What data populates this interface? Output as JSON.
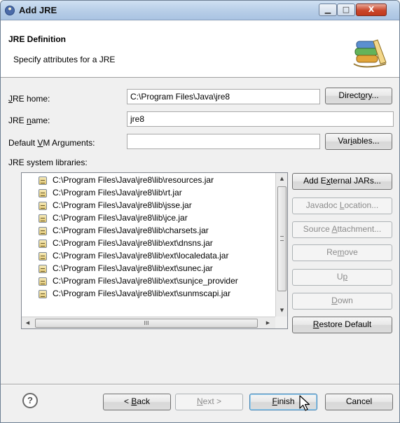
{
  "window": {
    "title": "Add JRE"
  },
  "header": {
    "title": "JRE Definition",
    "description": "Specify attributes for a JRE",
    "icon": "jre-books-icon"
  },
  "form": {
    "jre_home": {
      "label_pre": "",
      "label_u": "J",
      "label_post": "RE home:",
      "value": "C:\\Program Files\\Java\\jre8"
    },
    "directory_button": {
      "pre": "Direct",
      "u": "o",
      "post": "ry..."
    },
    "jre_name": {
      "label_pre": "JRE ",
      "label_u": "n",
      "label_post": "ame:",
      "value": "jre8"
    },
    "vm_args": {
      "label_pre": "Default ",
      "label_u": "V",
      "label_post": "M Arguments:",
      "value": ""
    },
    "variables_button": {
      "pre": "Var",
      "u": "i",
      "post": "ables..."
    },
    "libraries_label": "JRE system libraries:"
  },
  "libraries": [
    "C:\\Program Files\\Java\\jre8\\lib\\resources.jar",
    "C:\\Program Files\\Java\\jre8\\lib\\rt.jar",
    "C:\\Program Files\\Java\\jre8\\lib\\jsse.jar",
    "C:\\Program Files\\Java\\jre8\\lib\\jce.jar",
    "C:\\Program Files\\Java\\jre8\\lib\\charsets.jar",
    "C:\\Program Files\\Java\\jre8\\lib\\ext\\dnsns.jar",
    "C:\\Program Files\\Java\\jre8\\lib\\ext\\localedata.jar",
    "C:\\Program Files\\Java\\jre8\\lib\\ext\\sunec.jar",
    "C:\\Program Files\\Java\\jre8\\lib\\ext\\sunjce_provider",
    "C:\\Program Files\\Java\\jre8\\lib\\ext\\sunmscapi.jar"
  ],
  "library_buttons": {
    "add_external": {
      "pre": "Add E",
      "u": "x",
      "post": "ternal JARs..."
    },
    "javadoc": {
      "pre": "Javadoc ",
      "u": "L",
      "post": "ocation..."
    },
    "source": {
      "pre": "Source ",
      "u": "A",
      "post": "ttachment..."
    },
    "remove": {
      "pre": "Re",
      "u": "m",
      "post": "ove"
    },
    "up": {
      "pre": "U",
      "u": "p",
      "post": ""
    },
    "down": {
      "pre": "",
      "u": "D",
      "post": "own"
    },
    "restore": {
      "pre": "",
      "u": "R",
      "post": "estore Default"
    }
  },
  "footer": {
    "help": "?",
    "back": {
      "pre": "< ",
      "u": "B",
      "post": "ack"
    },
    "next": {
      "pre": "",
      "u": "N",
      "post": "ext >"
    },
    "finish": {
      "pre": "",
      "u": "F",
      "post": "inish"
    },
    "cancel": "Cancel"
  },
  "scroll_glyphs": {
    "up": "▲",
    "down": "▼",
    "left": "◀",
    "right": "▶",
    "h_grip": "III"
  },
  "titlebar_buttons": {
    "minimize": "▁",
    "maximize": "□",
    "close": "X"
  },
  "colors": {
    "title_bar": "#b9cfe8",
    "default_button_border": "#3c7fb1"
  }
}
